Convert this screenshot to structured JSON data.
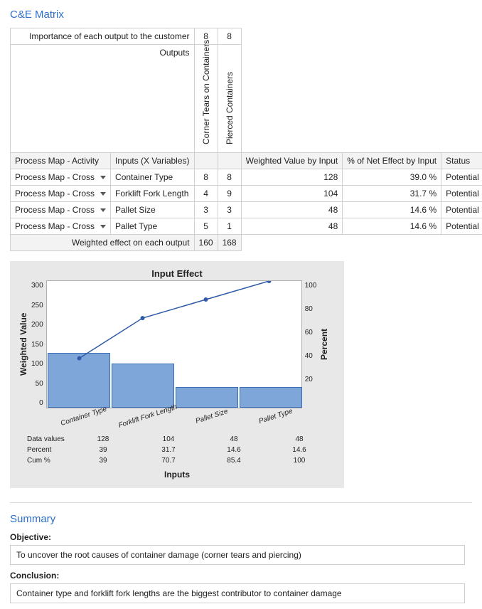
{
  "matrix": {
    "title": "C&E Matrix",
    "importance_label": "Importance of each output to the customer",
    "outputs_label": "Outputs",
    "importance_values": [
      "8",
      "8"
    ],
    "output_names": [
      "Corner Tears on Containers",
      "Pierced Containers"
    ],
    "col_headers": {
      "activity": "Process Map - Activity",
      "inputs": "Inputs (X Variables)",
      "weighted_by_input": "Weighted Value by Input",
      "pct_net_effect": "% of Net Effect by Input",
      "status": "Status"
    },
    "rows": [
      {
        "activity": "Process Map - Cross",
        "input": "Container Type",
        "v1": "8",
        "v2": "8",
        "weighted": "128",
        "pct": "39.0 %",
        "status": "Potential"
      },
      {
        "activity": "Process Map - Cross",
        "input": "Forklift Fork Length",
        "v1": "4",
        "v2": "9",
        "weighted": "104",
        "pct": "31.7 %",
        "status": "Potential"
      },
      {
        "activity": "Process Map - Cross",
        "input": "Pallet Size",
        "v1": "3",
        "v2": "3",
        "weighted": "48",
        "pct": "14.6 %",
        "status": "Potential"
      },
      {
        "activity": "Process Map - Cross",
        "input": "Pallet Type",
        "v1": "5",
        "v2": "1",
        "weighted": "48",
        "pct": "14.6 %",
        "status": "Potential"
      }
    ],
    "footer_label": "Weighted effect on each output",
    "footer_values": [
      "160",
      "168"
    ]
  },
  "chart_data": {
    "type": "bar",
    "title": "Input Effect",
    "categories": [
      "Container Type",
      "Forklift Fork Length",
      "Pallet Size",
      "Pallet Type"
    ],
    "series": [
      {
        "name": "Weighted Value",
        "axis": "left",
        "type": "bar",
        "values": [
          128,
          104,
          48,
          48
        ]
      },
      {
        "name": "Cum %",
        "axis": "right",
        "type": "line",
        "values": [
          39,
          70.7,
          85.4,
          100
        ]
      }
    ],
    "ylabel_left": "Weighted Value",
    "ylabel_right": "Percent",
    "ylim_left": [
      0,
      300
    ],
    "ylim_right": [
      0,
      100
    ],
    "yticks_left": [
      "0",
      "50",
      "100",
      "150",
      "200",
      "250",
      "300"
    ],
    "yticks_right": [
      "20",
      "40",
      "60",
      "80",
      "100"
    ],
    "xlabel": "Inputs",
    "data_rows": {
      "data_values_label": "Data values",
      "percent_label": "Percent",
      "cum_label": "Cum %",
      "percent": [
        "39",
        "31.7",
        "14.6",
        "14.6"
      ],
      "cum": [
        "39",
        "70.7",
        "85.4",
        "100"
      ]
    }
  },
  "summary": {
    "title": "Summary",
    "objective_label": "Objective:",
    "objective_text": "To uncover the root causes of container damage (corner tears and piercing)",
    "conclusion_label": "Conclusion:",
    "conclusion_text": "Container type and forklift fork lengths are the biggest contributor to container damage"
  }
}
